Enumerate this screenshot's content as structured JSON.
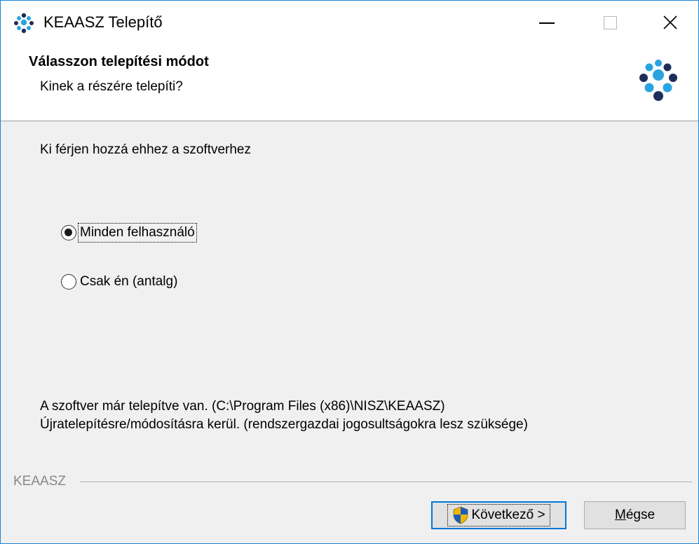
{
  "window": {
    "title": "KEAASZ Telepítő"
  },
  "header": {
    "title": "Válasszon telepítési módot",
    "subtitle": "Kinek a részére telepíti?"
  },
  "main": {
    "prompt": "Ki férjen hozzá ehhez a szoftverhez",
    "options": [
      {
        "label": "Minden felhasználó",
        "selected": true
      },
      {
        "label": "Csak én (antalg)",
        "selected": false
      }
    ],
    "info_line1": "A szoftver már telepítve van. (C:\\Program Files (x86)\\NISZ\\KEAASZ)",
    "info_line2": "Újratelepítésre/módosításra kerül. (rendszergazdai jogosultságokra lesz szüksége)"
  },
  "footer": {
    "brand": "KEAASZ",
    "next_label": "Következő >",
    "cancel_prefix": "",
    "cancel_mnemonic": "M",
    "cancel_rest": "égse"
  },
  "colors": {
    "accent": "#0078d7",
    "window_border": "#1883d7",
    "logo_dark": "#1f2d5a",
    "logo_light": "#2aa3e0"
  },
  "icons": {
    "app": "keaasz-logo-icon",
    "shield": "uac-shield-icon"
  }
}
